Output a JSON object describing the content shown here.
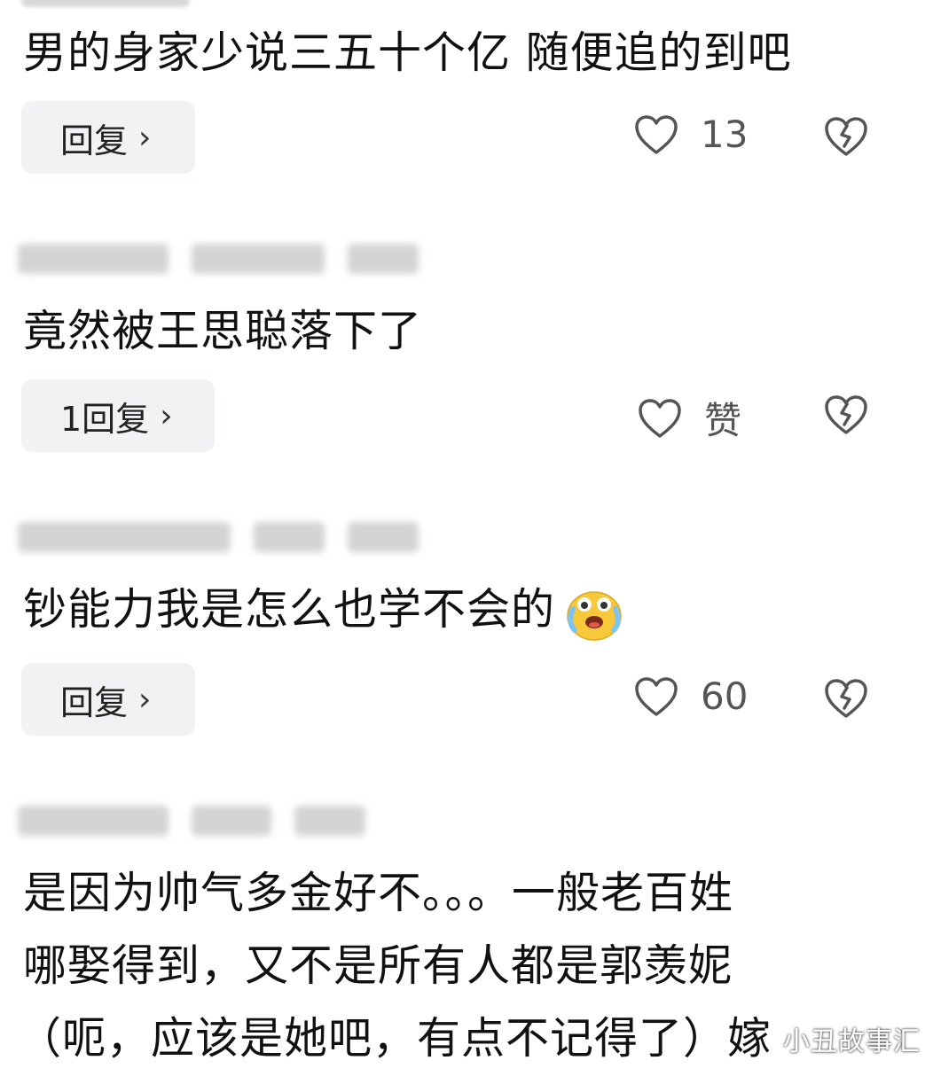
{
  "comments": [
    {
      "text": "男的身家少说三五十个亿 随便追的到吧",
      "reply_label": "回复",
      "like_count": "13"
    },
    {
      "text": "竟然被王思聪落下了",
      "reply_label": "1回复",
      "like_count": "赞"
    },
    {
      "text": "钞能力我是怎么也学不会的",
      "reply_label": "回复",
      "like_count": "60",
      "emoji": "crying-laughing-emoji"
    },
    {
      "text_lines": [
        "是因为帅气多金好不。。。一般老百姓",
        "哪娶得到，又不是所有人都是郭羡妮",
        "（呃，应该是她吧，有点不记得了）嫁"
      ]
    }
  ],
  "icons": {
    "like": "heart-outline-icon",
    "dislike": "broken-heart-icon",
    "reply_chevron": "chevron-right-icon"
  },
  "colors": {
    "reply_button_bg": "#f1f2f4",
    "icon_stroke": "#555555",
    "text": "#111111"
  },
  "watermark": "小丑故事汇"
}
